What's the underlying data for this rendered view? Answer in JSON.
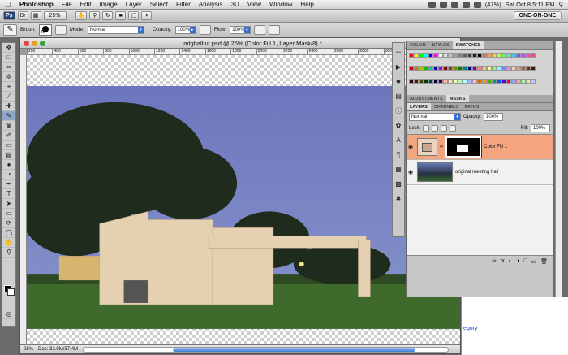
{
  "menubar": {
    "app_name": "Photoshop",
    "menus": [
      "File",
      "Edit",
      "Image",
      "Layer",
      "Select",
      "Filter",
      "Analysis",
      "3D",
      "View",
      "Window",
      "Help"
    ],
    "battery": "(47%)",
    "clock": "Sat Oct 8  5:11 PM"
  },
  "appbar": {
    "zoom": "25%",
    "workspace": "ONE-ON-ONE"
  },
  "options": {
    "brush_label": "Brush:",
    "brush_size": "30",
    "mode_label": "Mode:",
    "mode_value": "Normal",
    "opacity_label": "Opacity:",
    "opacity_value": "100%",
    "flow_label": "Flow:",
    "flow_value": "100%"
  },
  "document": {
    "title": "mtghalltut.psd @ 25% (Color Fill 1, Layer Mask/8) *",
    "ruler_ticks": [
      "200",
      "400",
      "600",
      "800",
      "1000",
      "1200",
      "1400",
      "1600",
      "1800",
      "2000",
      "2200",
      "2400",
      "2600",
      "2800",
      "3000",
      "3200",
      "3400"
    ],
    "zoom": "25%",
    "doc_info": "Doc: 32.9M/37.4M"
  },
  "panels": {
    "top_tabs": [
      "COLOR",
      "STYLES",
      "SWATCHES"
    ],
    "mid_tabs": [
      "ADJUSTMENTS",
      "MASKS"
    ],
    "layer_tabs": [
      "LAYERS",
      "CHANNELS",
      "PATHS"
    ],
    "blend_mode": "Normal",
    "opacity_label": "Opacity:",
    "opacity_value": "100%",
    "lock_label": "Lock:",
    "fill_label": "Fill:",
    "fill_value": "100%",
    "layers": [
      {
        "name": "Color Fill 1"
      },
      {
        "name": "original meeting hall"
      }
    ]
  },
  "help": {
    "link_fragment": "egory"
  },
  "colors": {
    "active_layer": "#f2a57e",
    "selection_blue": "#3b6ed4",
    "sky": "#7886c4"
  },
  "swatches": [
    "#ff0000",
    "#ffff00",
    "#00ff00",
    "#00ffff",
    "#0000ff",
    "#ff00ff",
    "#ffffff",
    "#e0e0e0",
    "#c0c0c0",
    "#a0a0a0",
    "#808080",
    "#606060",
    "#404040",
    "#202020",
    "#000000",
    "#ff6060",
    "#ff9f40",
    "#ffd040",
    "#c0ff40",
    "#60ff60",
    "#40ffc0",
    "#40c0ff",
    "#6060ff",
    "#c040ff",
    "#ff40c0",
    "#ff4080",
    "#c00000",
    "#c08000",
    "#c0c000",
    "#00c000",
    "#00c0c0",
    "#0000c0",
    "#c000c0",
    "#800000",
    "#804000",
    "#808000",
    "#008000",
    "#008080",
    "#000080",
    "#800080",
    "#ff8080",
    "#ffc080",
    "#ffff80",
    "#80ff80",
    "#80ffff",
    "#8080ff",
    "#ff80ff",
    "#f0d0b0",
    "#d0a080",
    "#a06040",
    "#603020",
    "#302010",
    "#400000",
    "#402000",
    "#404000",
    "#004000",
    "#004040",
    "#000040",
    "#400040",
    "#ffb0b0",
    "#ffe0b0",
    "#ffffb0",
    "#b0ffb0",
    "#b0ffff",
    "#b0b0ff",
    "#ffb0ff",
    "#e06000",
    "#e0a000",
    "#60a000",
    "#00a060",
    "#0060e0",
    "#6000e0",
    "#e00060",
    "#a0a0ff",
    "#ffa0a0",
    "#a0ffa0",
    "#ffe0a0",
    "#c0c0ff"
  ]
}
